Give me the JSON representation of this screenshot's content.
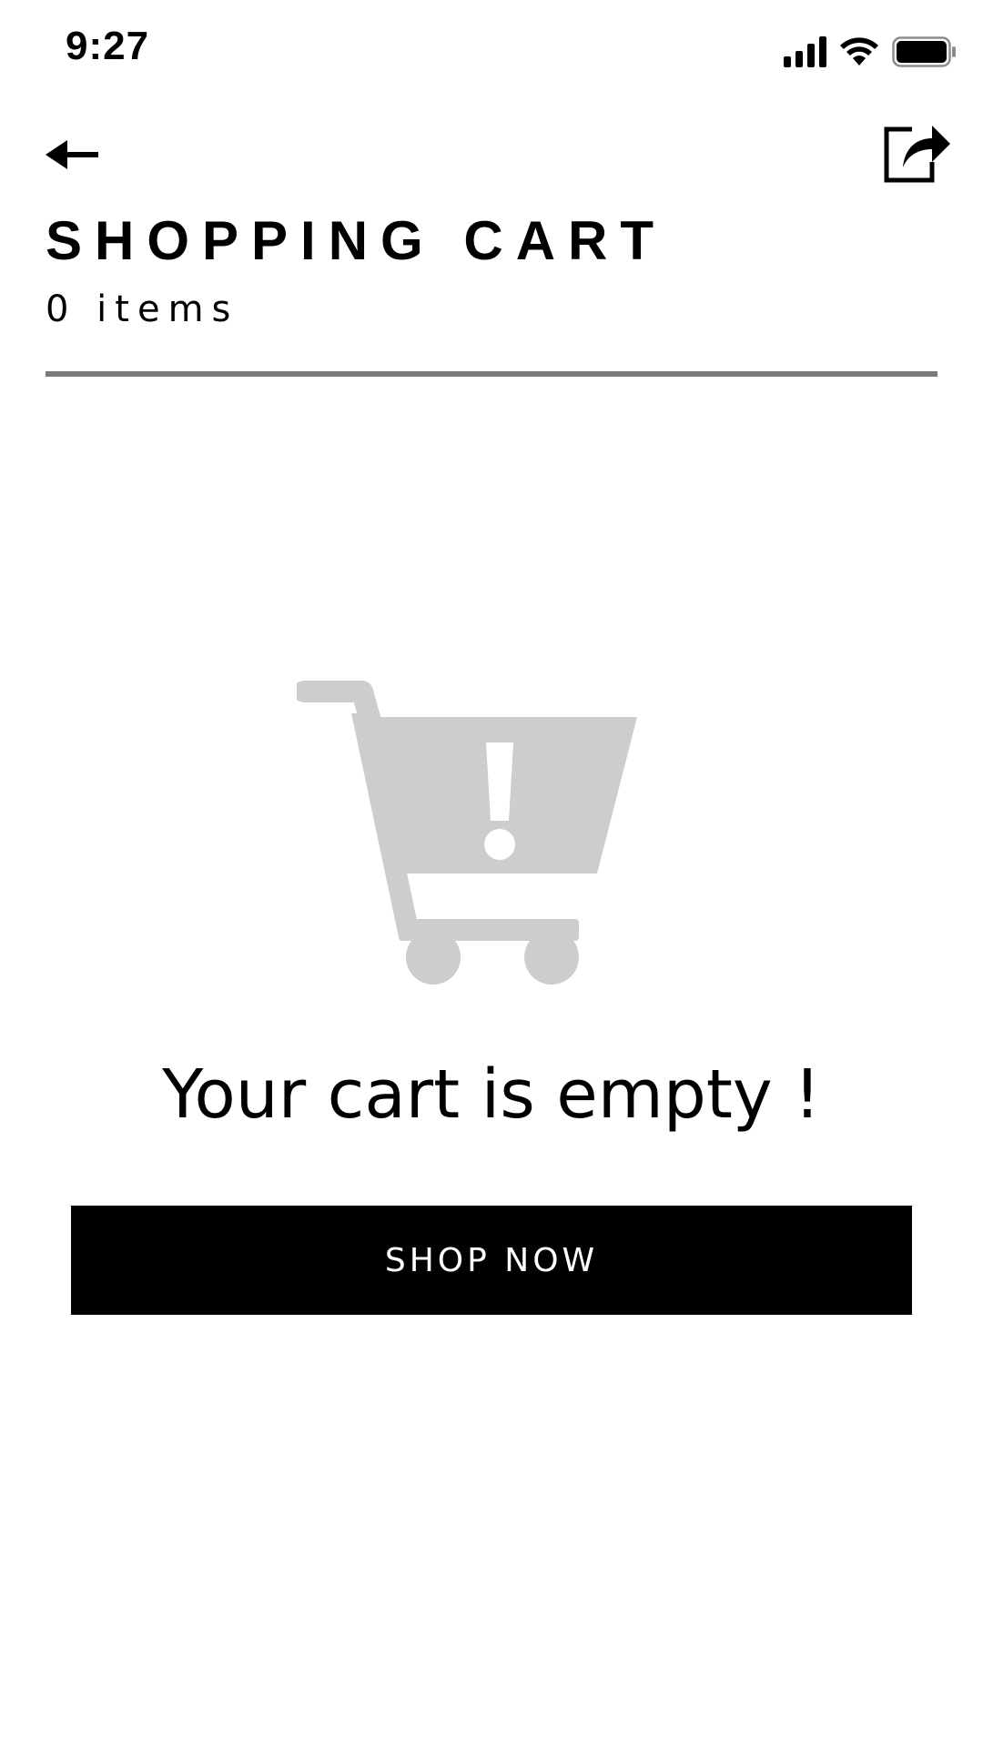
{
  "status_bar": {
    "time": "9:27",
    "icons": [
      "cellular-signal-icon",
      "wifi-icon",
      "battery-icon"
    ]
  },
  "header": {
    "back_icon": "arrow-left-icon",
    "share_icon": "share-icon",
    "title": "SHOPPING CART",
    "item_count": "0 items"
  },
  "empty_state": {
    "illustration_icon": "empty-cart-warning-icon",
    "message": "Your cart is empty !",
    "button_label": "SHOP NOW"
  },
  "colors": {
    "background": "#ffffff",
    "text": "#000000",
    "divider": "#7a7a7a",
    "illustration": "#cdcdcf",
    "button_background": "#000000",
    "button_text": "#ffffff"
  }
}
